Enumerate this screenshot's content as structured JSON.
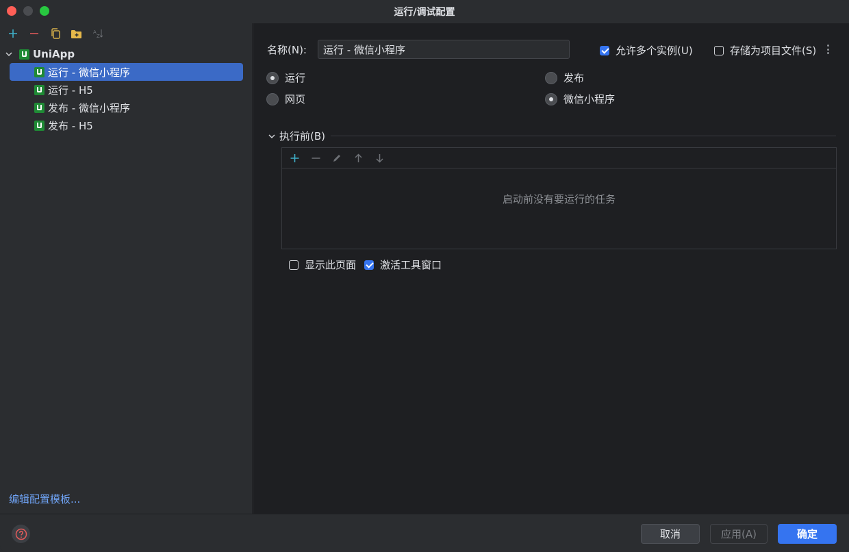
{
  "window": {
    "title": "运行/调试配置"
  },
  "left": {
    "tree": {
      "root": {
        "label": "UniApp"
      },
      "items": [
        {
          "label": "运行 - 微信小程序",
          "selected": true
        },
        {
          "label": "运行 - H5",
          "selected": false
        },
        {
          "label": "发布 - 微信小程序",
          "selected": false
        },
        {
          "label": "发布 - H5",
          "selected": false
        }
      ]
    },
    "edit_templates_link": "编辑配置模板..."
  },
  "main": {
    "name_label": "名称(N):",
    "name_value": "运行 - 微信小程序",
    "allow_multiple": {
      "label": "允许多个实例(U)",
      "checked": true
    },
    "store_as_project": {
      "label": "存储为项目文件(S)",
      "checked": false
    },
    "mode": {
      "run": {
        "label": "运行",
        "selected": true
      },
      "publish": {
        "label": "发布",
        "selected": false
      }
    },
    "platform": {
      "web": {
        "label": "网页",
        "selected": false
      },
      "wechat": {
        "label": "微信小程序",
        "selected": true
      }
    },
    "before_launch": {
      "title": "执行前(B)",
      "empty_text": "启动前没有要运行的任务"
    },
    "show_page": {
      "label": "显示此页面",
      "checked": false
    },
    "activate_tool_window": {
      "label": "激活工具窗口",
      "checked": true
    }
  },
  "footer": {
    "cancel_label": "取消",
    "apply_label": "应用(A)",
    "ok_label": "确定"
  },
  "colors": {
    "accent": "#3574f0",
    "selection": "#3b6ac6",
    "uniapp_icon": "#1f8a35",
    "link": "#6fa3f5",
    "add_icon": "#3fb0c9",
    "remove_icon": "#e55b5b"
  }
}
